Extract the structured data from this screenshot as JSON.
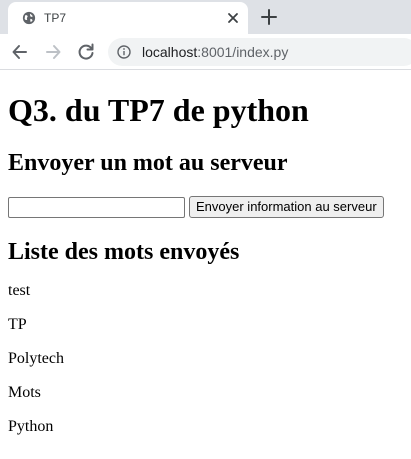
{
  "browser": {
    "tab": {
      "title": "TP7",
      "favicon_icon": "globe-icon",
      "close_icon": "close-icon"
    },
    "new_tab_icon": "plus-icon",
    "nav": {
      "back_icon": "arrow-left-icon",
      "forward_icon": "arrow-right-icon",
      "reload_icon": "reload-icon"
    },
    "address_bar": {
      "info_icon": "info-icon",
      "url_host": "localhost",
      "url_rest": ":8001/index.py"
    }
  },
  "page": {
    "title": "Q3. du TP7 de python",
    "send_heading": "Envoyer un mot au serveur",
    "form": {
      "input_value": "",
      "submit_label": "Envoyer information au serveur"
    },
    "list_heading": "Liste des mots envoyés",
    "words": [
      "test",
      "TP",
      "Polytech",
      "Mots",
      "Python"
    ]
  },
  "colors": {
    "tabstrip": "#dee1e6",
    "omnibox": "#f1f3f4",
    "icon": "#5f6368"
  }
}
